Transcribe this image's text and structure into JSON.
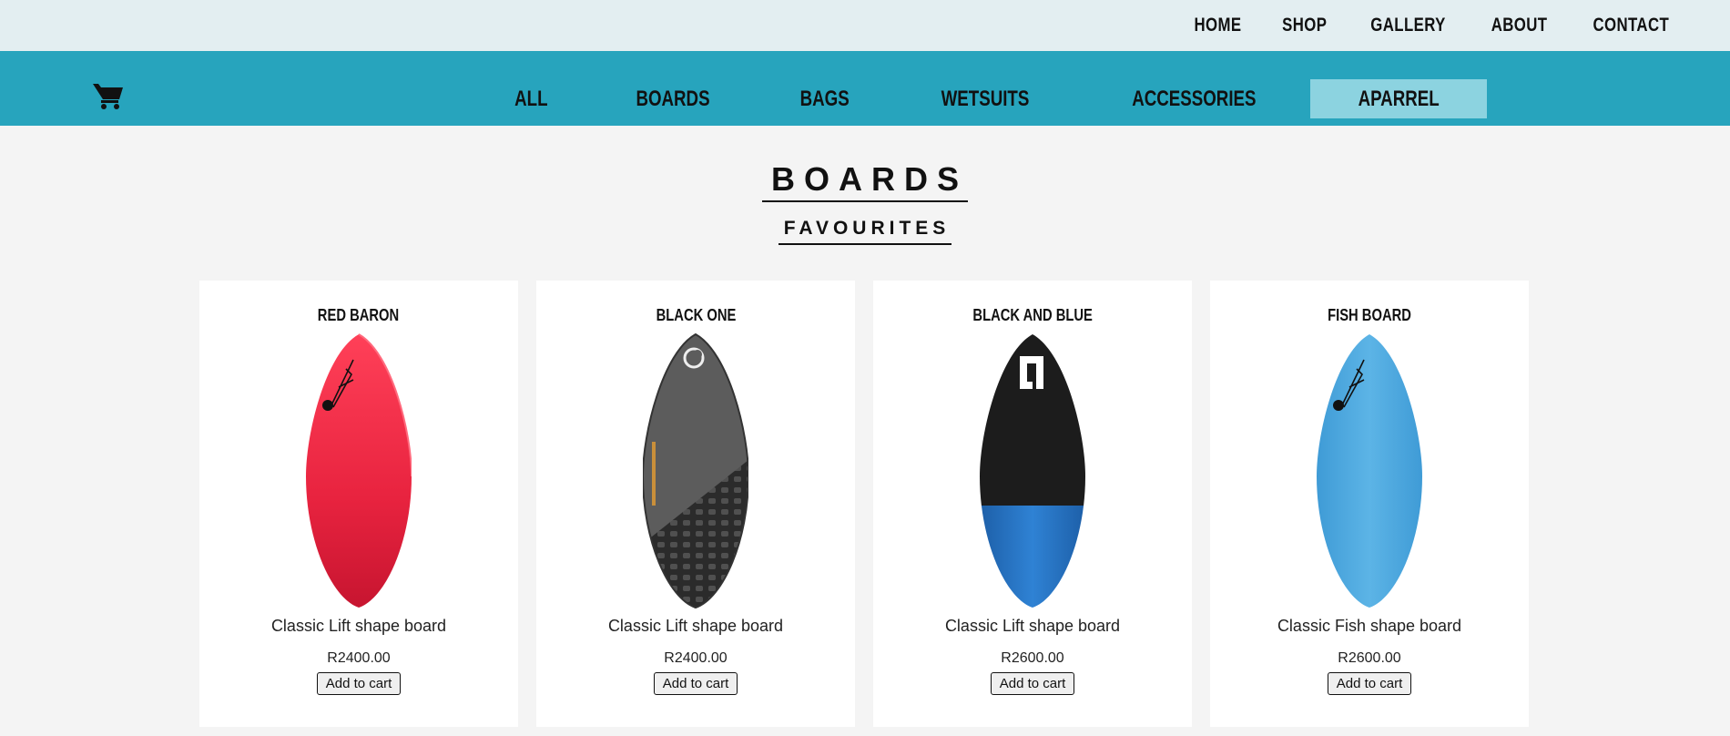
{
  "nav": {
    "items": [
      {
        "label": "HOME"
      },
      {
        "label": "SHOP"
      },
      {
        "label": "GALLERY"
      },
      {
        "label": "ABOUT"
      },
      {
        "label": "CONTACT"
      }
    ]
  },
  "categories": [
    {
      "label": "ALL"
    },
    {
      "label": "BOARDS"
    },
    {
      "label": "BAGS"
    },
    {
      "label": "WETSUITS"
    },
    {
      "label": "ACCESSORIES"
    },
    {
      "label": "APARREL"
    }
  ],
  "page": {
    "title": "BOARDS",
    "subtitle": "FAVOURITES"
  },
  "products": [
    {
      "name": "RED BARON",
      "description": "Classic Lift shape board",
      "price": "R2400.00",
      "button": "Add to cart"
    },
    {
      "name": "BLACK ONE",
      "description": "Classic Lift shape board",
      "price": "R2400.00",
      "button": "Add to cart"
    },
    {
      "name": "BLACK AND BLUE",
      "description": "Classic Lift shape board",
      "price": "R2600.00",
      "button": "Add to cart"
    },
    {
      "name": "FISH BOARD",
      "description": "Classic Fish shape board",
      "price": "R2600.00",
      "button": "Add to cart"
    }
  ],
  "colors": {
    "topbar": "#e3eef1",
    "category_bar": "#27a4bd",
    "active_category": "#8cd3e0",
    "red_board": "#e8233f",
    "black_board": "#2a2a2a",
    "blue_board": "#4aa6dc"
  },
  "icons": {
    "cart": "shopping-cart-icon"
  }
}
